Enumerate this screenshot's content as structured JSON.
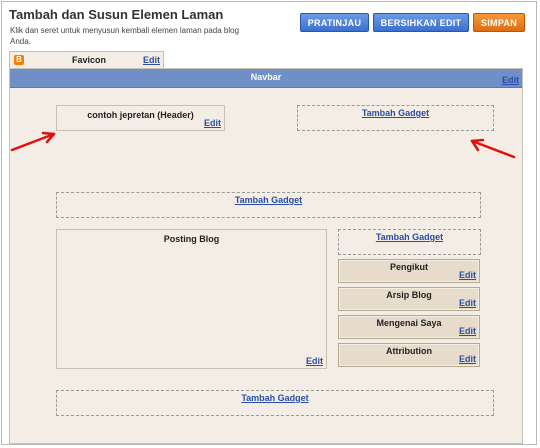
{
  "header": {
    "title": "Tambah dan Susun Elemen Laman",
    "subtitle": "Klik dan seret untuk menyusun kembali elemen laman pada blog Anda."
  },
  "toolbar": {
    "preview_label": "PRATINJAU",
    "clear_label": "BERSIHKAN EDIT",
    "save_label": "SIMPAN"
  },
  "favicon": {
    "label": "Favicon",
    "edit": "Edit"
  },
  "navbar": {
    "label": "Navbar",
    "edit": "Edit"
  },
  "header_gadget": {
    "label": "contoh jepretan (Header)",
    "edit": "Edit"
  },
  "add_gadget_label": "Tambah Gadget",
  "main": {
    "label": "Posting Blog",
    "edit": "Edit"
  },
  "sidebar": {
    "widgets": [
      {
        "label": "Pengikut",
        "edit": "Edit"
      },
      {
        "label": "Arsip Blog",
        "edit": "Edit"
      },
      {
        "label": "Mengenai Saya",
        "edit": "Edit"
      },
      {
        "label": "Attribution",
        "edit": "Edit"
      }
    ]
  },
  "colors": {
    "navbar": "#6f8fc6",
    "canvas": "#f3ede5",
    "button_blue": "#3b6fcf",
    "button_orange": "#e06b10",
    "arrow": "#e01010",
    "link": "#2a4ea6"
  },
  "icons": {
    "favicon": "blogger-icon"
  }
}
